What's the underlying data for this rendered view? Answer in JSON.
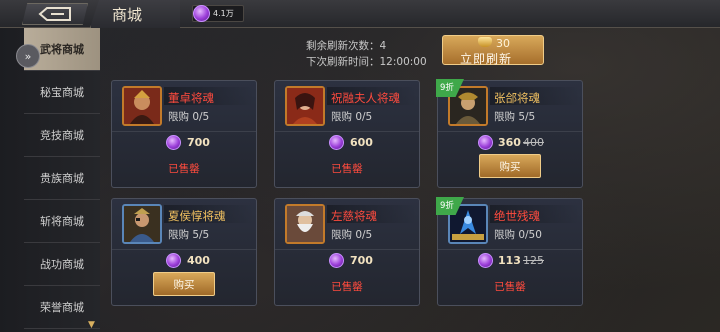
{
  "header": {
    "title": "商城",
    "currency_value": "4.1万"
  },
  "sidebar": {
    "items": [
      {
        "label": "武将商城",
        "active": true
      },
      {
        "label": "秘宝商城",
        "active": false
      },
      {
        "label": "竞技商城",
        "active": false
      },
      {
        "label": "贵族商城",
        "active": false
      },
      {
        "label": "斩将商城",
        "active": false
      },
      {
        "label": "战功商城",
        "active": false
      },
      {
        "label": "荣誉商城",
        "active": false
      }
    ]
  },
  "refresh": {
    "remaining_label": "剩余刷新次数：",
    "remaining_count": "4",
    "next_label": "下次刷新时间：",
    "next_time": "12:00:00",
    "cost": "30",
    "button_label": "立即刷新"
  },
  "cards": [
    {
      "name": "董卓将魂",
      "name_color": "red",
      "limit": "限购  0/5",
      "price": "700",
      "old_price": "",
      "discount": "",
      "status": "已售罄",
      "button": ""
    },
    {
      "name": "祝融夫人将魂",
      "name_color": "red",
      "limit": "限购  0/5",
      "price": "600",
      "old_price": "",
      "discount": "",
      "status": "已售罄",
      "button": ""
    },
    {
      "name": "张郃将魂",
      "name_color": "gold",
      "limit": "限购  5/5",
      "price": "360",
      "old_price": "400",
      "discount": "9折",
      "status": "",
      "button": "购买"
    },
    {
      "name": "夏侯惇将魂",
      "name_color": "gold",
      "limit": "限购  5/5",
      "price": "400",
      "old_price": "",
      "discount": "",
      "status": "",
      "button": "购买"
    },
    {
      "name": "左慈将魂",
      "name_color": "red",
      "limit": "限购  0/5",
      "price": "700",
      "old_price": "",
      "discount": "",
      "status": "已售罄",
      "button": ""
    },
    {
      "name": "绝世残魂",
      "name_color": "red",
      "limit": "限购  0/50",
      "price": "113",
      "old_price": "125",
      "discount": "9折",
      "status": "已售罄",
      "button": ""
    }
  ],
  "colors": {
    "active_tab": "#b9ad9a",
    "soldout": "#ff4b3e",
    "gold_name": "#f0c060",
    "discount_tag": "#3fa84a",
    "button": "#d8a85a"
  }
}
